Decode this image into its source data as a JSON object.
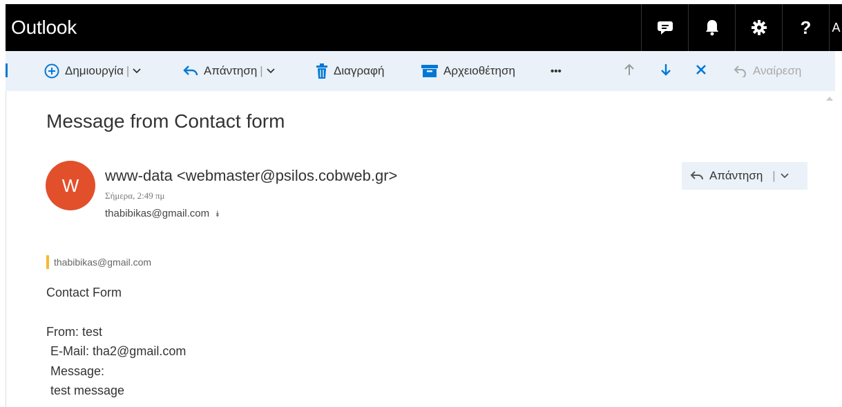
{
  "app": {
    "title": "Outlook",
    "avatar_letter": "A"
  },
  "top_icons": [
    "chat-icon",
    "bell-icon",
    "gear-icon",
    "help-icon"
  ],
  "toolbar": {
    "new_label": "Δημιουργία",
    "reply_label": "Απάντηση",
    "delete_label": "Διαγραφή",
    "archive_label": "Αρχειοθέτηση",
    "more_label": "•••",
    "undo_label": "Αναίρεση"
  },
  "message": {
    "subject": "Message from Contact form",
    "sender_initial": "W",
    "sender": "www-data <webmaster@psilos.cobweb.gr>",
    "date": "Σήμερα, 2:49 πμ",
    "to": "thabibikas@gmail.com",
    "reply_button": "Απάντηση",
    "quoted_email": "thabibikas@gmail.com",
    "body": {
      "heading": "Contact Form",
      "from": "From: test",
      "email": "E-Mail: tha2@gmail.com",
      "message_label": "Message:",
      "message_text": "test message"
    }
  },
  "colors": {
    "accent": "#0078d4",
    "avatar": "#e1502b",
    "command_bar": "#eaf1f8",
    "quote_bar": "#f6b935"
  }
}
